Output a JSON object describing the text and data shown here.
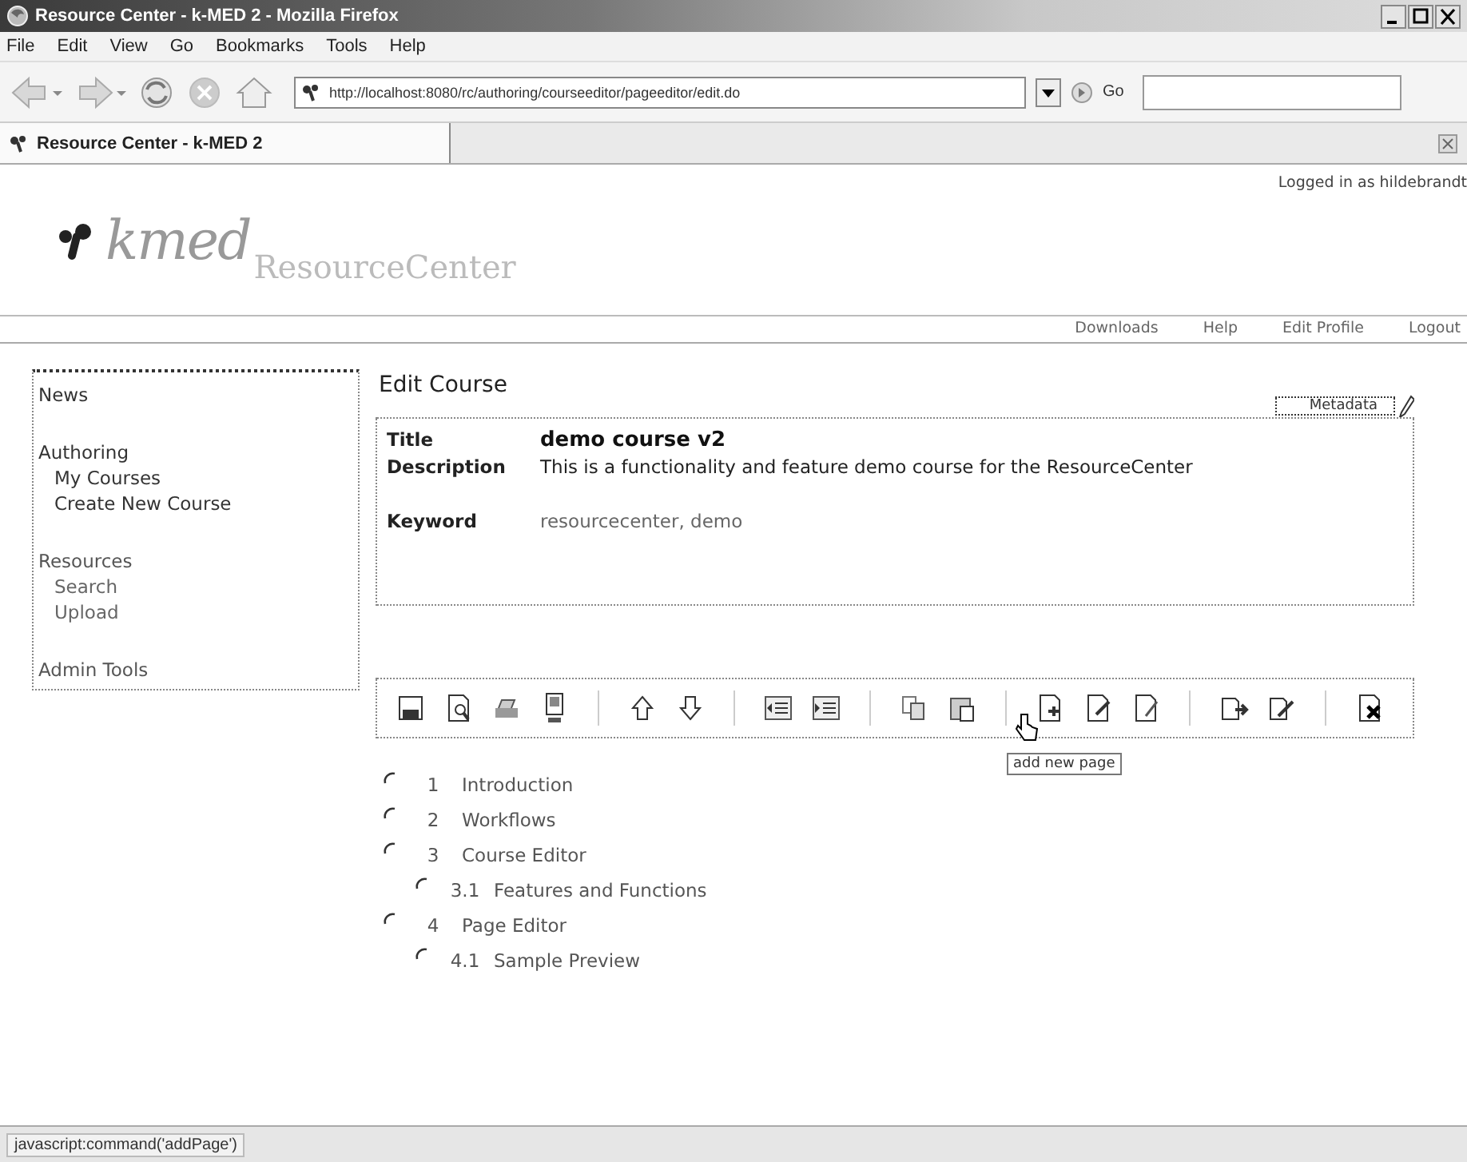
{
  "window": {
    "title": "Resource Center - k-MED 2 - Mozilla Firefox"
  },
  "menu": [
    "File",
    "Edit",
    "View",
    "Go",
    "Bookmarks",
    "Tools",
    "Help"
  ],
  "address": {
    "value": "http://localhost:8080/rc/authoring/courseeditor/pageeditor/edit.do"
  },
  "go_button": "Go",
  "tabs": [
    {
      "label": "Resource Center - k-MED 2",
      "selected": true
    }
  ],
  "header": {
    "logo": "kmed",
    "product": "ResourceCenter",
    "login": "Logged in as hildebrandt"
  },
  "nav_links": [
    "Downloads",
    "Help",
    "Edit Profile",
    "Logout"
  ],
  "sidebar": [
    {
      "label": "News"
    },
    {
      "label": "Authoring",
      "children": [
        {
          "label": "My Courses"
        },
        {
          "label": "Create New Course"
        }
      ]
    },
    {
      "label": "Resources",
      "children": [
        {
          "label": "Search"
        },
        {
          "label": "Upload"
        }
      ]
    },
    {
      "label": "Admin Tools"
    }
  ],
  "heading": "Edit Course",
  "metadata_button": "Metadata",
  "course": [
    {
      "label": "Title",
      "value": "demo course v2",
      "kind": "title"
    },
    {
      "label": "Description",
      "value": "This is a functionality and feature demo course for the ResourceCenter",
      "kind": "text"
    },
    {
      "label": "Keyword",
      "value": "resourcecenter, demo",
      "kind": "muted"
    }
  ],
  "tooltip": "add new page",
  "outline": [
    {
      "number": "1",
      "title": "Introduction",
      "selected": false
    },
    {
      "number": "2",
      "title": "Workflows",
      "selected": false
    },
    {
      "number": "3",
      "title": "Course Editor",
      "selected": false,
      "children": [
        {
          "number": "3.1",
          "title": "Features and Functions",
          "selected": false
        }
      ]
    },
    {
      "number": "4",
      "title": "Page Editor",
      "selected": false,
      "children": [
        {
          "number": "4.1",
          "title": "Sample Preview",
          "selected": false
        }
      ]
    }
  ],
  "status_bar": "javascript:command('addPage')"
}
